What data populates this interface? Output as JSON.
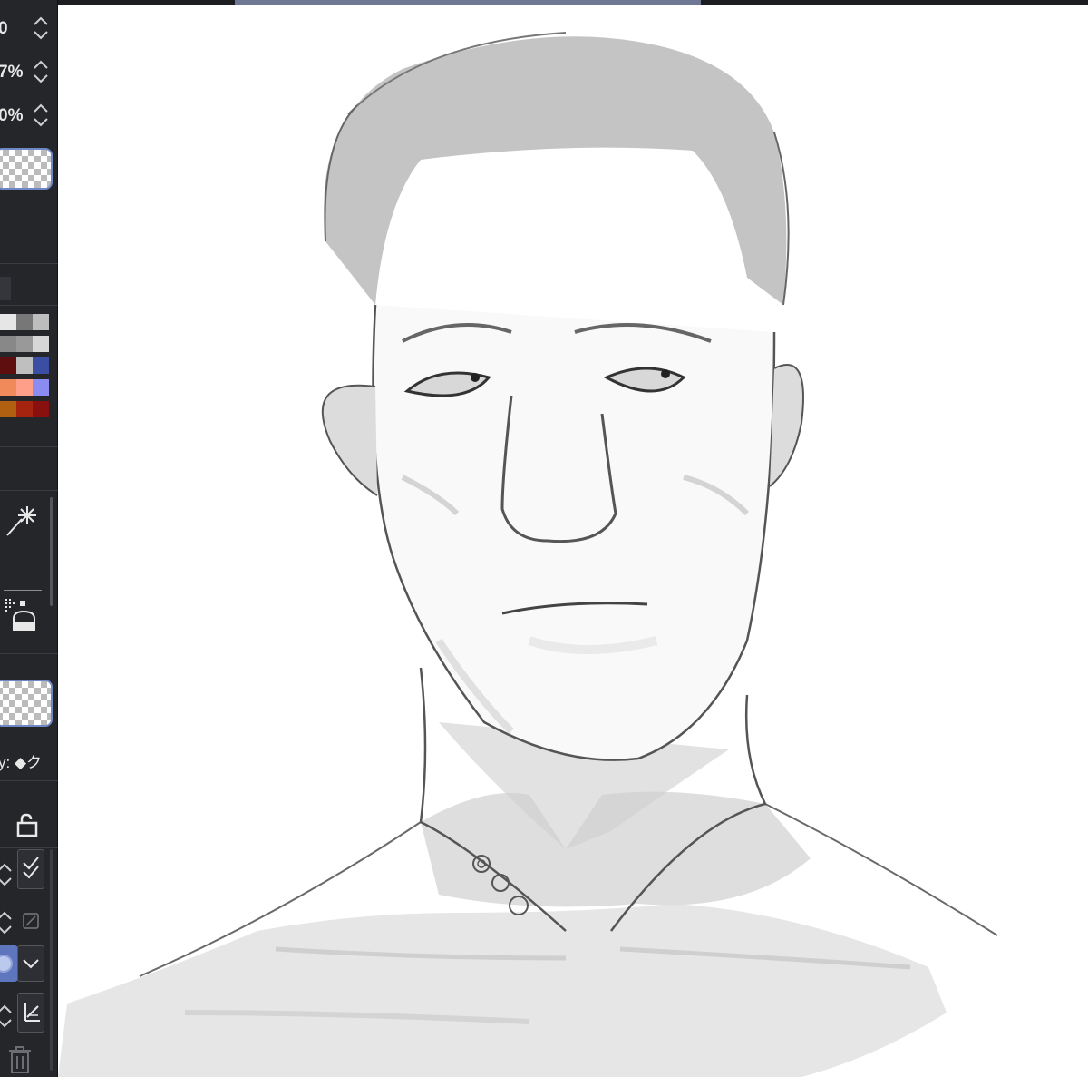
{
  "sidebar": {
    "values": [
      {
        "text": "0",
        "label": "brush-size-value"
      },
      {
        "text": "7%",
        "label": "opacity-value"
      },
      {
        "text": "0%",
        "label": "flow-value"
      }
    ],
    "property_label": "y: ◆ク",
    "palette_colors": [
      "#e6e6e6",
      "#777777",
      "#bdbdbd",
      "#888888",
      "#999999",
      "#d7d7d7",
      "#5e0e0e",
      "#bfbfbf",
      "#3a4fa3",
      "#f08a5a",
      "#ff9f8a",
      "#8a8cf2",
      "#b06010",
      "#a52410",
      "#8a1010"
    ]
  },
  "topbar": {
    "accent": "#6f7893"
  },
  "canvas": {
    "background": "#ffffff"
  }
}
